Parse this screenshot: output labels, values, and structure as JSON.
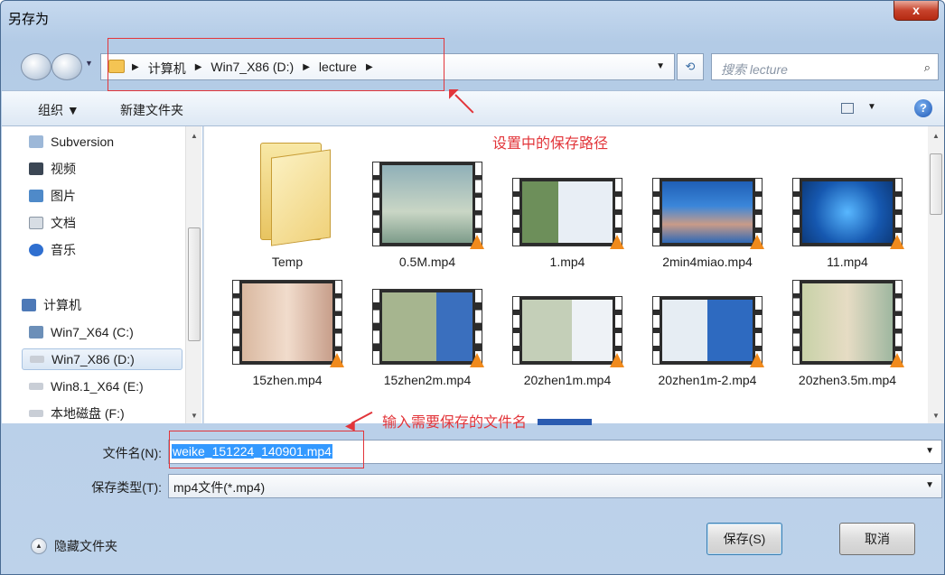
{
  "window": {
    "title": "另存为",
    "close_label": "x"
  },
  "address": {
    "crumbs": [
      "计算机",
      "Win7_X86 (D:)",
      "lecture"
    ],
    "search_placeholder": "搜索 lecture"
  },
  "toolbar": {
    "organize_label": "组织 ▼",
    "new_folder_label": "新建文件夹",
    "help_label": "?"
  },
  "nav_pane": {
    "items": [
      {
        "label": "Subversion",
        "icon": "subversion-icon",
        "color": "#9db8d8"
      },
      {
        "label": "视频",
        "icon": "video-icon",
        "color": "#3b4654"
      },
      {
        "label": "图片",
        "icon": "picture-icon",
        "color": "#4f8ac9"
      },
      {
        "label": "文档",
        "icon": "document-icon",
        "color": "#d7dde4"
      },
      {
        "label": "音乐",
        "icon": "music-icon",
        "color": "#2f6fd0"
      },
      {
        "label": "计算机",
        "icon": "computer-icon",
        "color": "#4d79b7"
      },
      {
        "label": "Win7_X64 (C:)",
        "icon": "windows-drive-icon",
        "color": "#6c8fb8"
      },
      {
        "label": "Win7_X86 (D:)",
        "icon": "drive-icon",
        "color": "#c9ced6"
      },
      {
        "label": "Win8.1_X64 (E:)",
        "icon": "drive-icon",
        "color": "#c9ced6"
      },
      {
        "label": "本地磁盘 (F:)",
        "icon": "drive-icon",
        "color": "#c9ced6"
      }
    ]
  },
  "files": {
    "row1": [
      "Temp",
      "0.5M.mp4",
      "1.mp4",
      "2min4miao.mp4",
      "11.mp4"
    ],
    "row2": [
      "15zhen.mp4",
      "15zhen2m.mp4",
      "20zhen1m.mp4",
      "20zhen1m-2.mp4",
      "20zhen3.5m.mp4"
    ]
  },
  "form": {
    "filename_label": "文件名(N):",
    "filename_value": "weike_151224_140901.mp4",
    "type_label": "保存类型(T):",
    "type_value": "mp4文件(*.mp4)"
  },
  "footer": {
    "hide_folders_label": "隐藏文件夹",
    "save_label": "保存(S)",
    "cancel_label": "取消"
  },
  "annotations": {
    "path_note": "设置中的保存路径",
    "filename_note": "输入需要保存的文件名",
    "color": "#e2353a"
  }
}
